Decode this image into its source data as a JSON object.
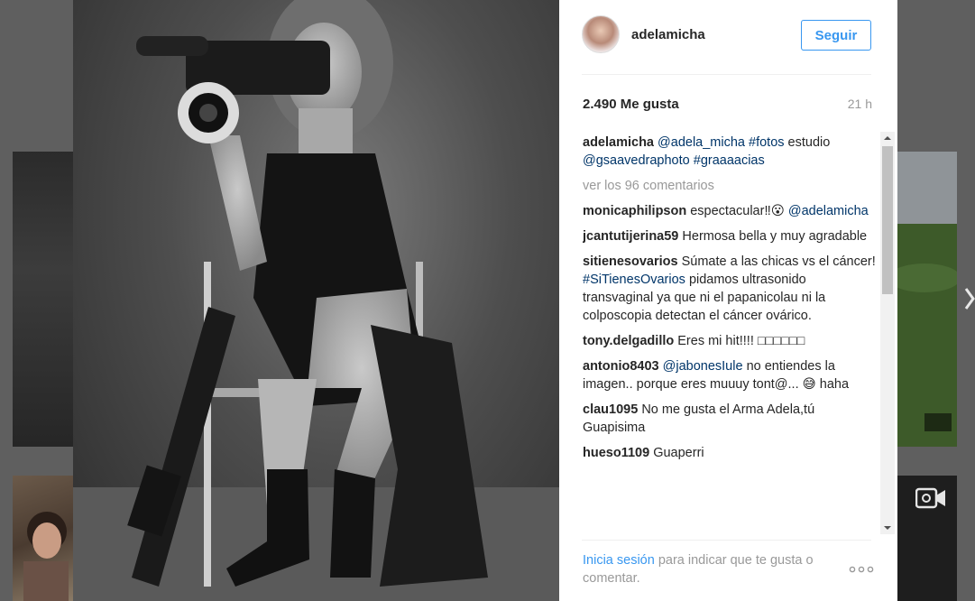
{
  "post": {
    "username": "adelamicha",
    "follow_label": "Seguir",
    "likes": "2.490 Me gusta",
    "time": "21 h"
  },
  "caption": {
    "user": "adelamicha",
    "mention": "@adela_micha",
    "tag1": "#fotos",
    "text1": "estudio",
    "mention2": "@gsaavedraphoto",
    "tag2": "#graaaacias"
  },
  "view_comments": "ver los 96 comentarios",
  "comments": [
    {
      "user": "monicaphilipson",
      "text": "espectacular‼😮",
      "mention": "@adelamicha"
    },
    {
      "user": "jcantutijerina59",
      "text": "Hermosa bella y muy agradable"
    },
    {
      "user": "sitienesovarios",
      "text1": "Súmate a las chicas vs el cáncer!",
      "tag": "#SiTienesOvarios",
      "text2": "pidamos ultrasonido transvaginal ya que ni el papanicolau ni la colposcopia detectan el cáncer ovárico."
    },
    {
      "user": "tony.delgadillo",
      "text": "Eres mi hit!!!! □□□□□□"
    },
    {
      "user": "antonio8403",
      "mention": "@jabonesIule",
      "text": "no entiendes la imagen.. porque eres muuuy tont@... 😅 haha"
    },
    {
      "user": "clau1095",
      "text": "No me gusta el Arma Adela,tú Guapisima"
    },
    {
      "user": "hueso1109",
      "text": "Guaperri"
    }
  ],
  "footer": {
    "login_link": "Inicia sesión",
    "login_text": "para indicar que te gusta o comentar."
  },
  "icons": {
    "next": "chevron-right-icon",
    "more": "more-options-icon",
    "video": "video-camera-icon"
  },
  "colors": {
    "accent": "#3897f0",
    "link": "#003569",
    "muted": "#999999"
  }
}
